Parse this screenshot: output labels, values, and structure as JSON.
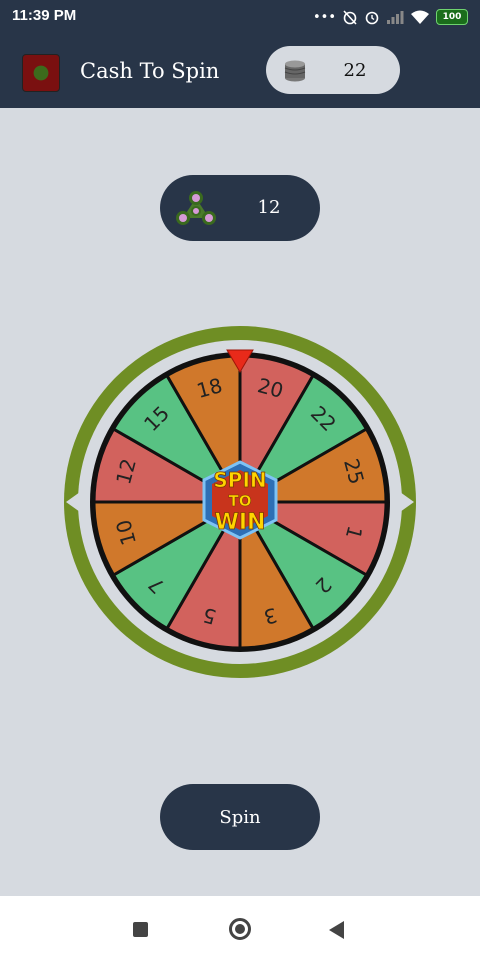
{
  "status_bar": {
    "time": "11:39 PM",
    "battery": "100",
    "icons": [
      "more-dots-icon",
      "alarm-off-icon",
      "alarm-icon",
      "signal-icon",
      "wifi-icon",
      "battery-icon"
    ]
  },
  "app_bar": {
    "title": "Cash To Spin",
    "coin_count": "22"
  },
  "spinner_balance": {
    "count": "12"
  },
  "wheel": {
    "center_label": [
      "SPIN",
      "TO",
      "WIN"
    ],
    "segments": [
      {
        "label": "20",
        "color": "#d2625d"
      },
      {
        "label": "22",
        "color": "#58c283"
      },
      {
        "label": "25",
        "color": "#d0782b"
      },
      {
        "label": "1",
        "color": "#d2625d"
      },
      {
        "label": "2",
        "color": "#58c283"
      },
      {
        "label": "3",
        "color": "#d0782b"
      },
      {
        "label": "5",
        "color": "#d2625d"
      },
      {
        "label": "7",
        "color": "#58c283"
      },
      {
        "label": "10",
        "color": "#d0782b"
      },
      {
        "label": "12",
        "color": "#d2625d"
      },
      {
        "label": "15",
        "color": "#58c283"
      },
      {
        "label": "18",
        "color": "#d0782b"
      }
    ],
    "rim_color": "#6f8e24",
    "pointer_color": "#e82a1a"
  },
  "actions": {
    "spin_label": "Spin"
  },
  "colors": {
    "header_bg": "#283548",
    "page_bg": "#d6dae0"
  }
}
